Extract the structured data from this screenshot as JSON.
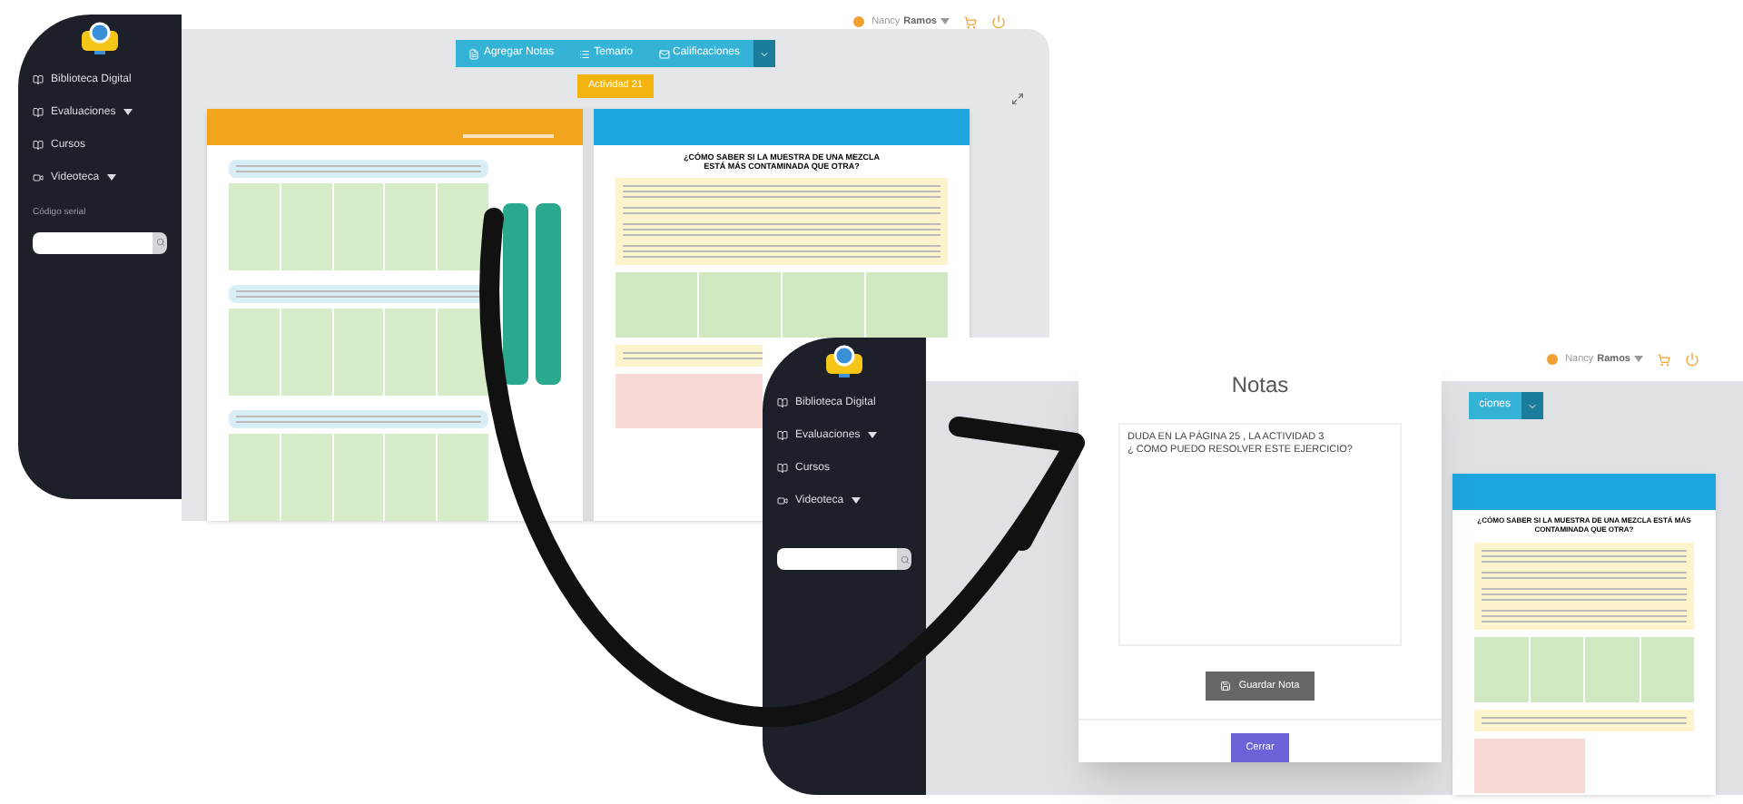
{
  "screen_1": {
    "user": {
      "first_name": "Nancy",
      "last_name": "Ramos",
      "has_menu": true
    },
    "sidebar": {
      "items": [
        {
          "label": "Biblioteca Digital",
          "has_menu": false
        },
        {
          "label": "Evaluaciones",
          "has_menu": true
        },
        {
          "label": "Cursos",
          "has_menu": false
        },
        {
          "label": "Videoteca",
          "has_menu": true
        }
      ],
      "serial_label": "Código serial"
    },
    "toolbar": [
      {
        "label": "Agregar Notas"
      },
      {
        "label": "Temario"
      },
      {
        "label": "Calificaciones"
      }
    ],
    "activity": "Actividad 21",
    "book": {
      "heading": "¿CÓMO SABER SI LA MUESTRA DE UNA MEZCLA ESTÁ MÁS CONTAMINADA QUE OTRA?"
    }
  },
  "screen_2": {
    "user": {
      "first_name": "Nancy",
      "last_name": "Ramos",
      "has_menu": true
    },
    "sidebar": {
      "items": [
        {
          "label": "Biblioteca Digital",
          "has_menu": false
        },
        {
          "label": "Evaluaciones",
          "has_menu": true
        },
        {
          "label": "Cursos",
          "has_menu": false
        },
        {
          "label": "Videoteca",
          "has_menu": true
        }
      ]
    },
    "toolbar_partial": "ciones",
    "book": {
      "heading": "¿CÓMO SABER SI LA MUESTRA DE UNA MEZCLA ESTÁ MÁS CONTAMINADA QUE OTRA?"
    },
    "modal": {
      "title": "Notas",
      "note": "DUDA EN LA PÁGINA 25 , LA ACTIVIDAD 3\n¿ COMO PUEDO RESOLVER ESTE EJERCICIO?",
      "save_button": "Guardar Nota",
      "close_button": "Cerrar"
    }
  }
}
